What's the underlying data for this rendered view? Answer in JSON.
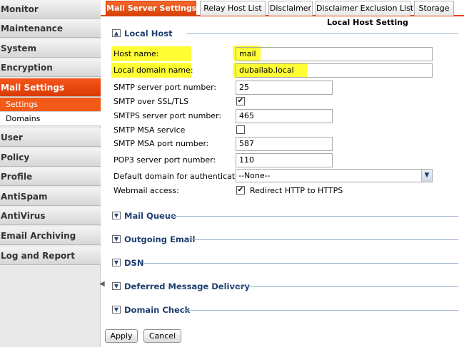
{
  "sidebar": {
    "items": [
      {
        "label": "Monitor"
      },
      {
        "label": "Maintenance"
      },
      {
        "label": "System"
      },
      {
        "label": "Encryption"
      },
      {
        "label": "Mail Settings"
      },
      {
        "label": "User"
      },
      {
        "label": "Policy"
      },
      {
        "label": "Profile"
      },
      {
        "label": "AntiSpam"
      },
      {
        "label": "AntiVirus"
      },
      {
        "label": "Email Archiving"
      },
      {
        "label": "Log and Report"
      }
    ],
    "subitems": [
      {
        "label": "Settings"
      },
      {
        "label": "Domains"
      }
    ]
  },
  "tabs": [
    {
      "label": "Mail Server Settings"
    },
    {
      "label": "Relay Host List"
    },
    {
      "label": "Disclaimer"
    },
    {
      "label": "Disclaimer Exclusion List"
    },
    {
      "label": "Storage"
    }
  ],
  "panel": {
    "title": "Local Host Setting"
  },
  "local_host": {
    "label": "Local Host",
    "host_name_label": "Host name:",
    "host_name_value": "mail",
    "local_domain_label": "Local domain name:",
    "local_domain_value": "dubailab.local",
    "smtp_port_label": "SMTP server port number:",
    "smtp_port_value": "25",
    "smtp_ssl_label": "SMTP over SSL/TLS",
    "smtp_ssl_checked": "✔",
    "smtps_port_label": "SMTPS server port number:",
    "smtps_port_value": "465",
    "msa_service_label": "SMTP MSA service",
    "msa_port_label": "SMTP MSA port number:",
    "msa_port_value": "587",
    "pop3_port_label": "POP3 server port number:",
    "pop3_port_value": "110",
    "default_domain_label": "Default domain for authentication:",
    "default_domain_value": "--None--",
    "webmail_label": "Webmail access:",
    "webmail_checked": "✔",
    "webmail_option": "Redirect HTTP to HTTPS"
  },
  "sections": [
    {
      "label": "Mail Queue"
    },
    {
      "label": "Outgoing Email"
    },
    {
      "label": "DSN"
    },
    {
      "label": "Deferred Message Delivery"
    },
    {
      "label": "Domain Check"
    }
  ],
  "buttons": {
    "apply": "Apply",
    "cancel": "Cancel"
  },
  "icons": {
    "collapse": "collapse-up-icon",
    "expand": "expand-down-icon",
    "sidebar_toggle": "chevron-left-icon",
    "dropdown": "chevron-down-icon"
  },
  "colors": {
    "accent": "#e14a10",
    "section_title": "#1e3f72",
    "highlight": "#ffff33"
  }
}
